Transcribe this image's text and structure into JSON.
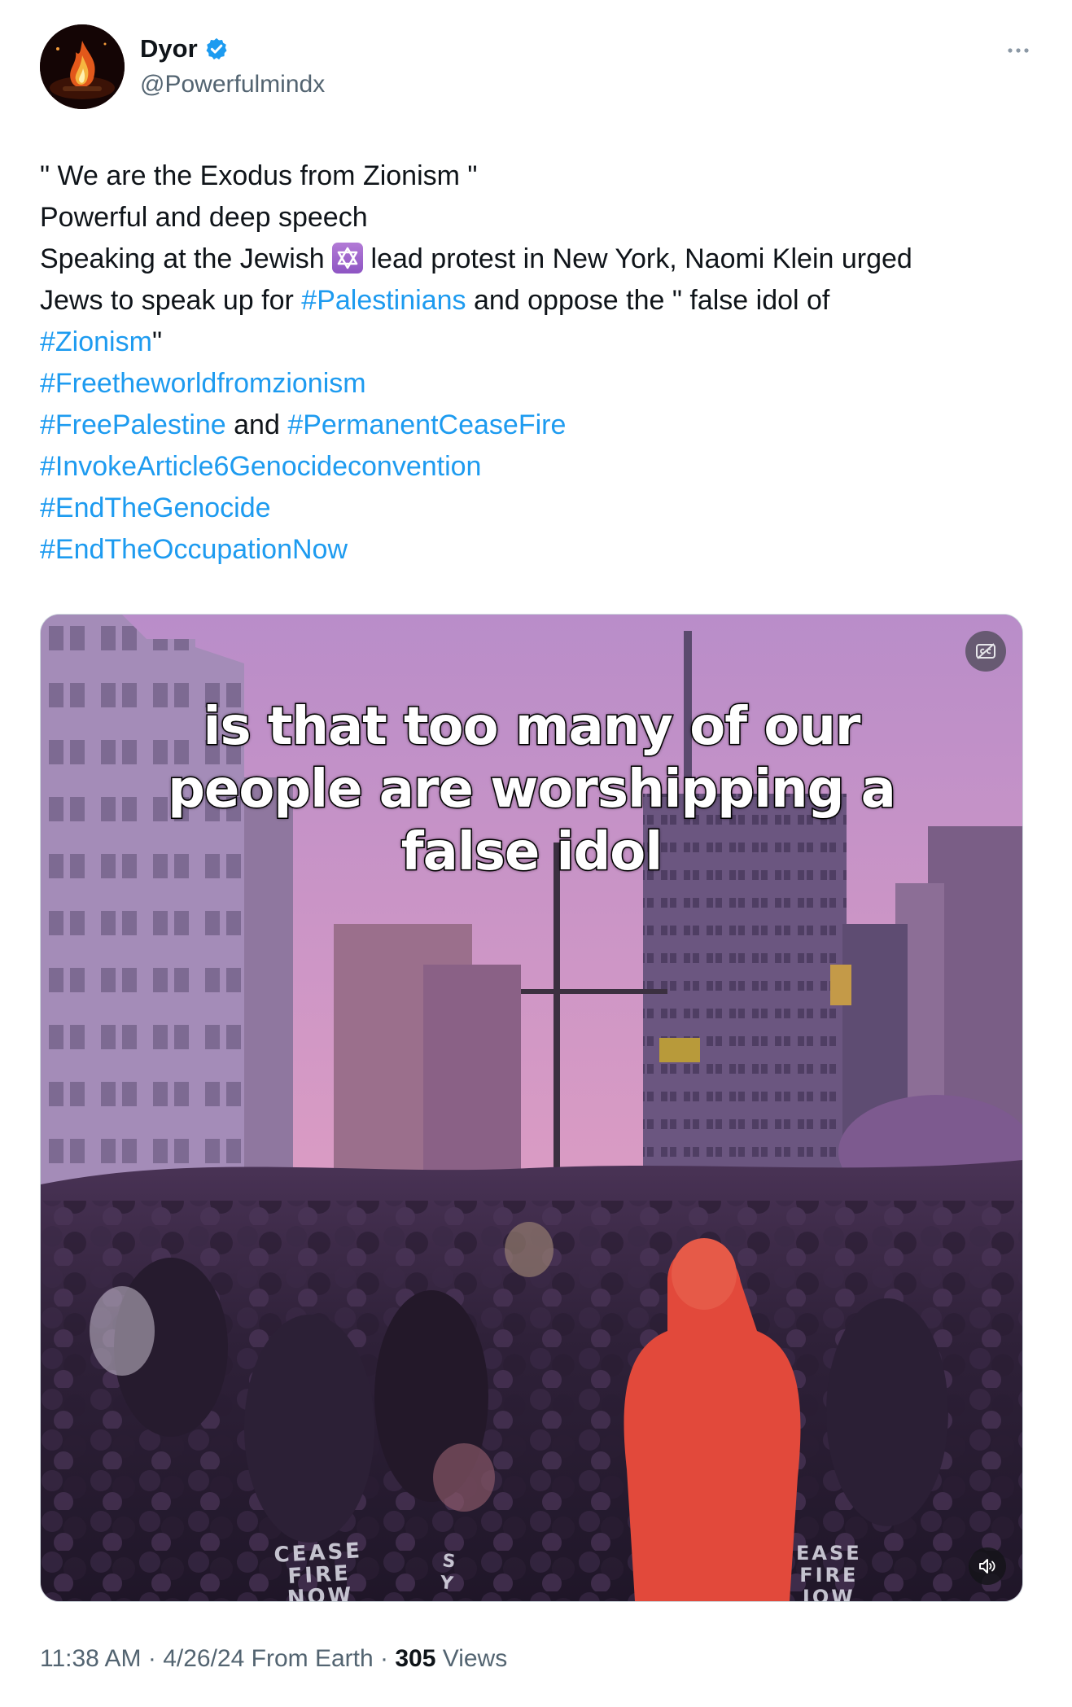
{
  "author": {
    "display_name": "Dyor",
    "handle": "@Powerfulmindx",
    "verified": true,
    "verified_icon": "verified-badge-icon",
    "avatar_icon": "fire-avatar"
  },
  "menu": {
    "more_icon": "more-horizontal-icon"
  },
  "tweet": {
    "line1": "\" We are the Exodus from Zionism \"",
    "line2": "Powerful and deep speech",
    "line3_a": "Speaking at the Jewish ",
    "line3_emoji": "star-of-david-icon",
    "line3_b": " lead  protest in New York, Naomi Klein urged",
    "line4_a": "Jews to speak up for ",
    "tag_palestinians": "#Palestinians",
    "line4_b": " and oppose the \" false idol of",
    "tag_zionism": "#Zionism",
    "line5_b": "\"",
    "tag_freetheworld": "#Freetheworldfromzionism",
    "tag_freepalestine": "#FreePalestine",
    "and_word": " and ",
    "tag_ceasefire": "#PermanentCeaseFire",
    "tag_article6": "#InvokeArticle6Genocideconvention",
    "tag_endgenocide": "#EndTheGenocide",
    "tag_endoccupation": "#EndTheOccupationNow"
  },
  "media": {
    "caption_lines": [
      "is that too many of our",
      "people are worshipping a",
      "false idol"
    ],
    "cc_icon": "closed-captions-icon",
    "volume_icon": "volume-muted-icon",
    "sign_left": [
      "CEASE",
      "FIRE",
      "NOW"
    ],
    "sign_middle": [
      "S",
      "Y"
    ],
    "sign_right": [
      "EASE",
      "FIRE",
      "IOW"
    ],
    "colors": {
      "sky_top": "#b98dc9",
      "sky_bottom": "#d99bc4",
      "crowd": "#2a1d33",
      "jacket": "#e2493b"
    }
  },
  "meta": {
    "time": "11:38 AM",
    "sep1": " · ",
    "date": "4/26/24",
    "from": " From Earth",
    "sep2": " · ",
    "views_count": "305",
    "views_label": " Views"
  }
}
